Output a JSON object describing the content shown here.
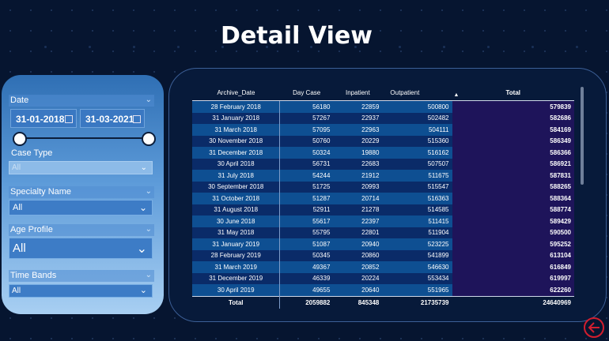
{
  "title": "Detail View",
  "filters": {
    "date_label": "Date",
    "date_from": "31-01-2018",
    "date_to": "31-03-2021",
    "case_type_label": "Case Type",
    "case_type_value": "All",
    "specialty_label": "Specialty Name",
    "specialty_value": "All",
    "age_label": "Age Profile",
    "age_value": "All",
    "time_label": "Time Bands",
    "time_value": "All"
  },
  "table": {
    "columns": [
      "Archive_Date",
      "Day Case",
      "Inpatient",
      "Outpatient",
      "Total"
    ],
    "rows": [
      [
        "28 February 2018",
        "56180",
        "22859",
        "500800",
        "579839"
      ],
      [
        "31 January 2018",
        "57267",
        "22937",
        "502482",
        "582686"
      ],
      [
        "31 March 2018",
        "57095",
        "22963",
        "504111",
        "584169"
      ],
      [
        "30 November 2018",
        "50760",
        "20229",
        "515360",
        "586349"
      ],
      [
        "31 December 2018",
        "50324",
        "19880",
        "516162",
        "586366"
      ],
      [
        "30 April 2018",
        "56731",
        "22683",
        "507507",
        "586921"
      ],
      [
        "31 July 2018",
        "54244",
        "21912",
        "511675",
        "587831"
      ],
      [
        "30 September 2018",
        "51725",
        "20993",
        "515547",
        "588265"
      ],
      [
        "31 October 2018",
        "51287",
        "20714",
        "516363",
        "588364"
      ],
      [
        "31 August 2018",
        "52911",
        "21278",
        "514585",
        "588774"
      ],
      [
        "30 June 2018",
        "55617",
        "22397",
        "511415",
        "589429"
      ],
      [
        "31 May 2018",
        "55795",
        "22801",
        "511904",
        "590500"
      ],
      [
        "31 January 2019",
        "51087",
        "20940",
        "523225",
        "595252"
      ],
      [
        "28 February 2019",
        "50345",
        "20860",
        "541899",
        "613104"
      ],
      [
        "31 March 2019",
        "49367",
        "20852",
        "546630",
        "616849"
      ],
      [
        "31 December 2019",
        "46339",
        "20224",
        "553434",
        "619997"
      ],
      [
        "30 April 2019",
        "49655",
        "20640",
        "551965",
        "622260"
      ]
    ],
    "total": [
      "Total",
      "2059882",
      "845348",
      "21735739",
      "24640969"
    ]
  }
}
